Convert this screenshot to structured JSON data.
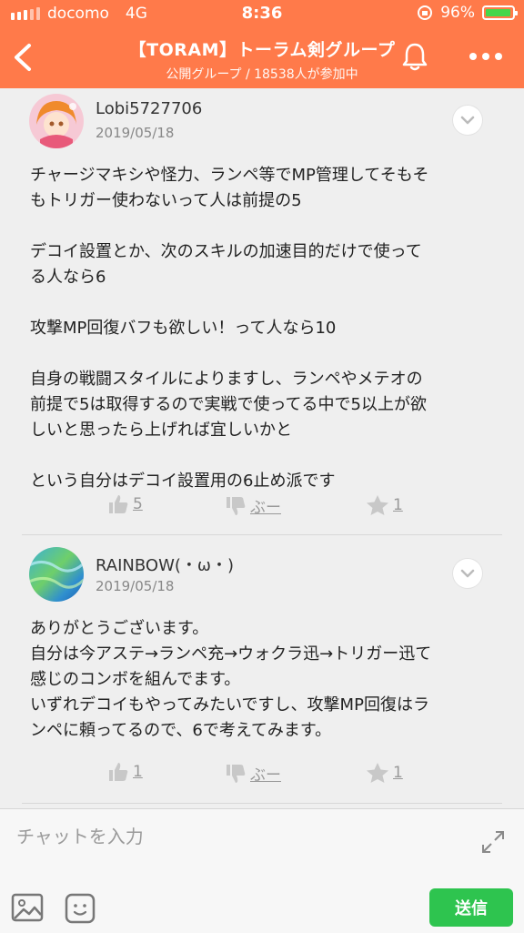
{
  "status": {
    "carrier": "docomo",
    "network": "4G",
    "time": "8:36",
    "battery": "96%",
    "battery_level": 0.96
  },
  "header": {
    "title": "【TORAM】トーラム剣グループ",
    "subtitle": "公開グループ / 18538人が参加中"
  },
  "posts": [
    {
      "username": "Lobi5727706",
      "date": "2019/05/18",
      "body": "チャージマキシや怪力、ランペ等でMP管理してそもそ\nもトリガー使わないって人は前提の5\n\nデコイ設置とか、次のスキルの加速目的だけで使って\nる人なら6\n\n攻撃MP回復バフも欲しい！って人なら10\n\n自身の戦闘スタイルによりますし、ランペやメテオの\n前提で5は取得するので実戦で使ってる中で5以上が欲\nしいと思ったら上げれば宜しいかと\n\nという自分はデコイ設置用の6止め派です",
      "likes": "5",
      "boo": "ぶー",
      "stars": "1"
    },
    {
      "username": "RAINBOW(・ω・)",
      "date": "2019/05/18",
      "body": "ありがとうございます。\n自分は今アステ→ランペ充→ウォクラ迅→トリガー迅て\n感じのコンボを組んでます。\nいずれデコイもやってみたいですし、攻撃MP回復はラ\nンペに頼ってるので、6で考えてみます。",
      "likes": "1",
      "boo": "ぶー",
      "stars": "1"
    }
  ],
  "composer": {
    "placeholder": "チャットを入力",
    "send_label": "送信"
  },
  "colors": {
    "header": "#ff7a4a",
    "send": "#2ec44f",
    "battery": "#44d64b"
  },
  "icons": [
    "back-icon",
    "bell-icon",
    "more-icon",
    "chevron-down-icon",
    "thumbs-up-icon",
    "thumbs-down-icon",
    "star-icon",
    "expand-icon",
    "image-icon",
    "emoji-icon"
  ]
}
